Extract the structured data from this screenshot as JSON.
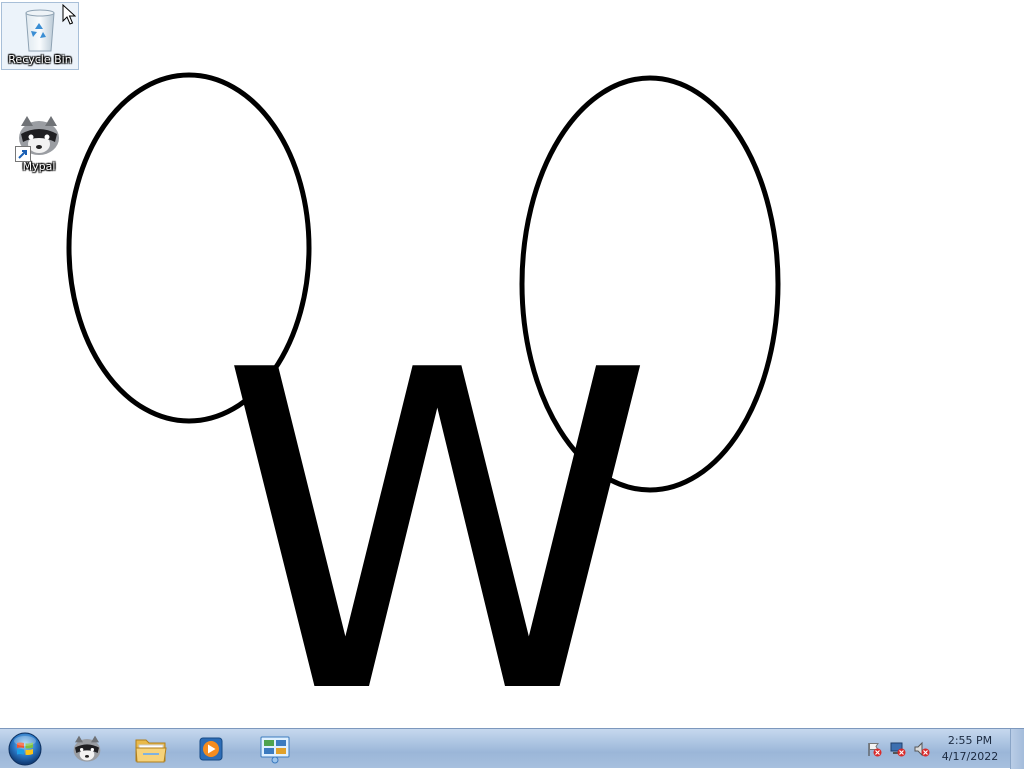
{
  "desktop": {
    "icons": [
      {
        "label": "Recycle Bin",
        "icon": "recycle-bin-icon"
      },
      {
        "label": "Mypal",
        "icon": "raccoon-icon"
      }
    ],
    "wallpaper": {
      "letter": "W"
    }
  },
  "taskbar": {
    "start": {
      "icon": "windows-start-orb-icon"
    },
    "pinned": [
      {
        "icon": "raccoon-icon"
      },
      {
        "icon": "folder-icon"
      },
      {
        "icon": "media-player-icon"
      },
      {
        "icon": "control-panel-icon"
      }
    ],
    "tray": {
      "icons": [
        "action-center-flag-icon",
        "network-icon",
        "volume-muted-icon"
      ],
      "time": "2:55 PM",
      "date": "4/17/2022"
    }
  },
  "colors": {
    "taskbar": "#a9c2e0",
    "wallpaper_bg": "#ffffff",
    "ink": "#000000"
  }
}
